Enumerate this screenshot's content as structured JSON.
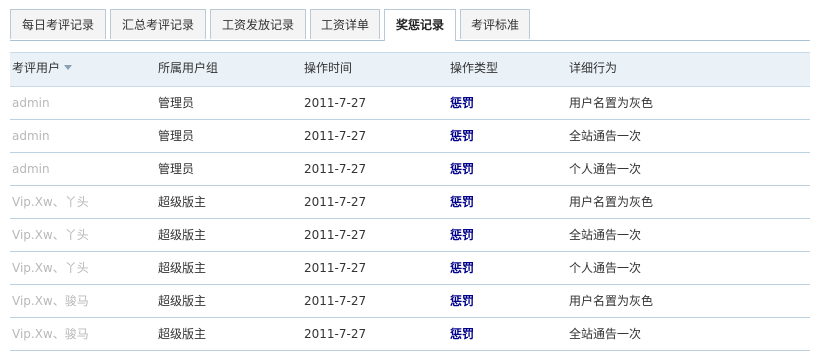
{
  "tabs": [
    {
      "label": "每日考评记录",
      "active": false
    },
    {
      "label": "汇总考评记录",
      "active": false
    },
    {
      "label": "工资发放记录",
      "active": false
    },
    {
      "label": "工资详单",
      "active": false
    },
    {
      "label": "奖惩记录",
      "active": true
    },
    {
      "label": "考评标准",
      "active": false
    }
  ],
  "table": {
    "headers": [
      "考评用户",
      "所属用户组",
      "操作时间",
      "操作类型",
      "详细行为"
    ],
    "rows": [
      [
        "admin",
        "管理员",
        "2011-7-27",
        "惩罚",
        "用户名置为灰色"
      ],
      [
        "admin",
        "管理员",
        "2011-7-27",
        "惩罚",
        "全站通告一次"
      ],
      [
        "admin",
        "管理员",
        "2011-7-27",
        "惩罚",
        "个人通告一次"
      ],
      [
        "Vip.Xw、丫头",
        "超级版主",
        "2011-7-27",
        "惩罚",
        "用户名置为灰色"
      ],
      [
        "Vip.Xw、丫头",
        "超级版主",
        "2011-7-27",
        "惩罚",
        "全站通告一次"
      ],
      [
        "Vip.Xw、丫头",
        "超级版主",
        "2011-7-27",
        "惩罚",
        "个人通告一次"
      ],
      [
        "Vip.Xw、骏马",
        "超级版主",
        "2011-7-27",
        "惩罚",
        "用户名置为灰色"
      ],
      [
        "Vip.Xw、骏马",
        "超级版主",
        "2011-7-27",
        "惩罚",
        "全站通告一次"
      ]
    ]
  },
  "colors": {
    "accent": "#2e6da4",
    "header_bg": "#eaf2f8",
    "type_text": "#00008b",
    "muted_user": "#b8b8b8"
  },
  "icons": {
    "sort": "sort-down-icon"
  }
}
